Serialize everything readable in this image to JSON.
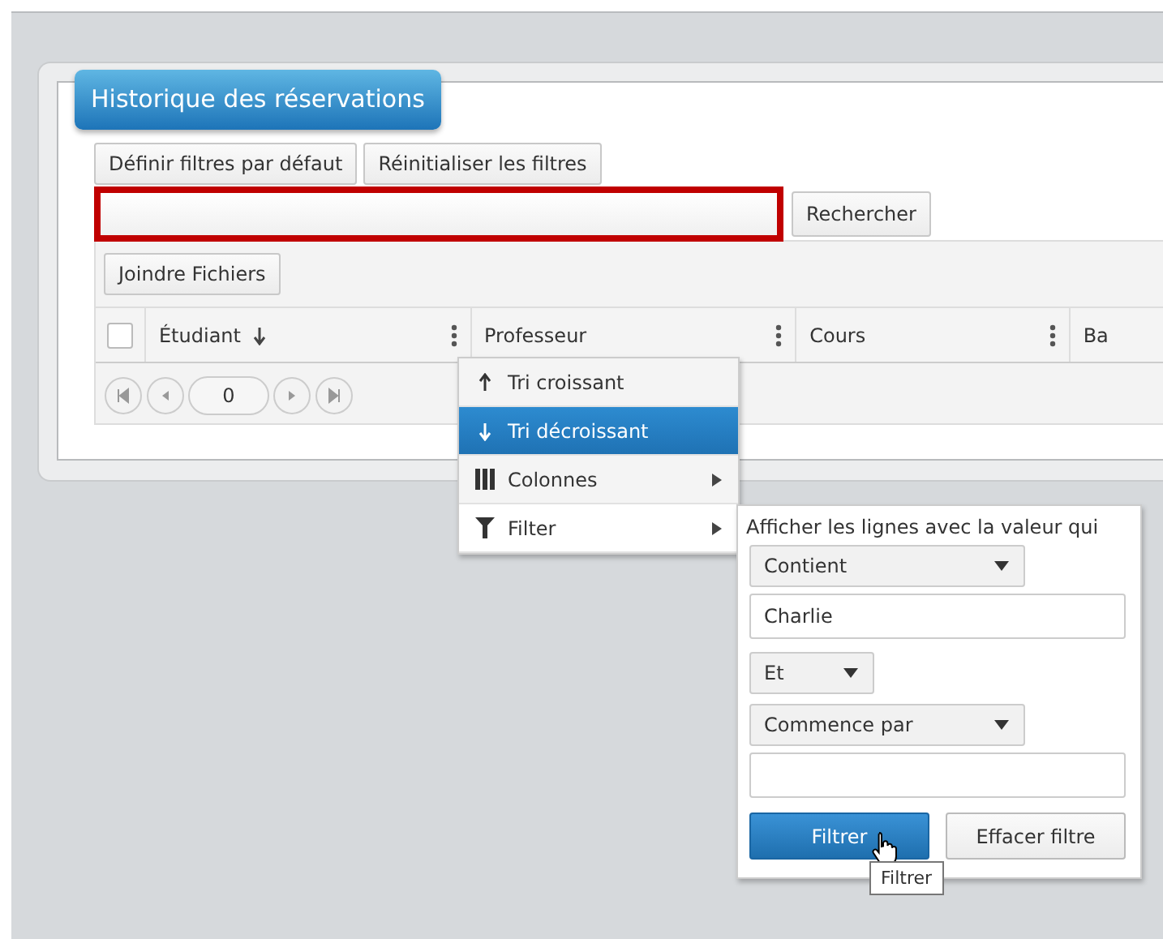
{
  "panel": {
    "title": "Historique des réservations"
  },
  "toolbar": {
    "buttons": [
      "Définir filtres par défaut",
      "Réinitialiser les filtres"
    ]
  },
  "search": {
    "highlighted": true,
    "button": "Rechercher"
  },
  "attach_button": "Joindre Fichiers",
  "grid": {
    "select_all_checked": false,
    "columns": [
      {
        "label": "Étudiant",
        "sorted_descending": true,
        "has_menu": true
      },
      {
        "label": "Professeur",
        "sorted_descending": false,
        "has_menu": true
      },
      {
        "label": "Cours",
        "sorted_descending": false,
        "has_menu": true
      },
      {
        "label": "Ba",
        "sorted_descending": false,
        "has_menu": false
      }
    ],
    "pager": {
      "page": "0"
    }
  },
  "column_menu": {
    "items": [
      {
        "kind": "sort-asc",
        "label": "Tri croissant",
        "selected": false,
        "submenu": false
      },
      {
        "kind": "sort-desc",
        "label": "Tri décroissant",
        "selected": true,
        "submenu": false
      },
      {
        "kind": "columns",
        "label": "Colonnes",
        "selected": false,
        "submenu": true
      },
      {
        "kind": "filter",
        "label": "Filter",
        "selected": false,
        "submenu": true
      }
    ]
  },
  "filter_popup": {
    "prompt": "Afficher les lignes avec la valeur qui",
    "condition_1": "Contient",
    "value_1": "Charlie",
    "operator": "Et",
    "condition_2": "Commence par",
    "apply_button": "Filtrer",
    "clear_button": "Effacer filtre",
    "apply_hovered": true
  },
  "tooltip": "Filtrer"
}
